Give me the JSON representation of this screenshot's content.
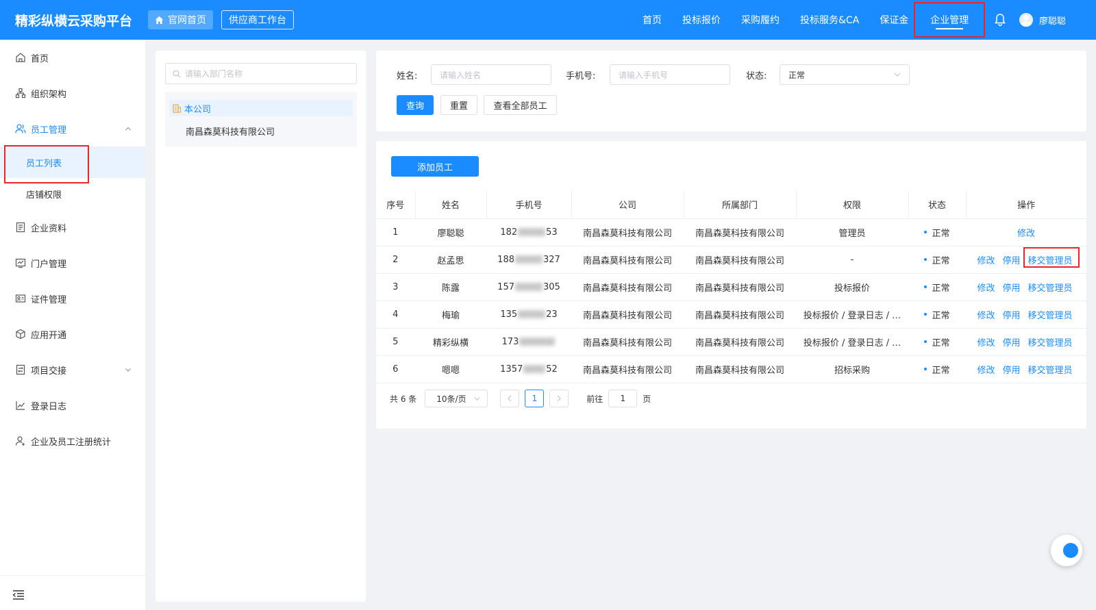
{
  "header": {
    "brand": "精彩纵横云采购平台",
    "home_btn": "官网首页",
    "workbench_btn": "供应商工作台",
    "nav": [
      "首页",
      "投标报价",
      "采购履约",
      "投标服务&CA",
      "保证金"
    ],
    "nav_active": "企业管理",
    "username": "廖聪聪"
  },
  "sidebar": {
    "items": [
      {
        "label": "首页",
        "icon": "home-icon"
      },
      {
        "label": "组织架构",
        "icon": "org-chart-icon"
      }
    ],
    "employee": {
      "label": "员工管理",
      "icon": "users-icon",
      "sub": [
        "员工列表",
        "店铺权限"
      ]
    },
    "items_after": [
      {
        "label": "企业资料",
        "icon": "document-icon"
      },
      {
        "label": "门户管理",
        "icon": "monitor-icon"
      },
      {
        "label": "证件管理",
        "icon": "id-card-icon"
      },
      {
        "label": "应用开通",
        "icon": "cube-icon"
      },
      {
        "label": "项目交接",
        "icon": "transfer-icon"
      },
      {
        "label": "登录日志",
        "icon": "chart-icon"
      },
      {
        "label": "企业及员工注册统计",
        "icon": "user-icon"
      }
    ]
  },
  "dept": {
    "search_placeholder": "请输入部门名称",
    "root": "本公司",
    "child": "南昌森莫科技有限公司"
  },
  "filters": {
    "name_label": "姓名:",
    "name_placeholder": "请输入姓名",
    "phone_label": "手机号:",
    "phone_placeholder": "请输入手机号",
    "status_label": "状态:",
    "status_value": "正常",
    "query_btn": "查询",
    "reset_btn": "重置",
    "view_all_btn": "查看全部员工"
  },
  "table": {
    "add_btn": "添加员工",
    "headers": [
      "序号",
      "姓名",
      "手机号",
      "公司",
      "所属部门",
      "权限",
      "状态",
      "操作"
    ],
    "rows": [
      {
        "no": "1",
        "name": "廖聪聪",
        "phone_a": "182",
        "phone_b": "53",
        "company": "南昌森莫科技有限公司",
        "dept": "南昌森莫科技有限公司",
        "perm": "管理员",
        "status": "正常"
      },
      {
        "no": "2",
        "name": "赵孟思",
        "phone_a": "188",
        "phone_b": "327",
        "company": "南昌森莫科技有限公司",
        "dept": "南昌森莫科技有限公司",
        "perm": "-",
        "status": "正常"
      },
      {
        "no": "3",
        "name": "陈露",
        "phone_a": "157",
        "phone_b": "305",
        "company": "南昌森莫科技有限公司",
        "dept": "南昌森莫科技有限公司",
        "perm": "投标报价",
        "status": "正常"
      },
      {
        "no": "4",
        "name": "梅瑜",
        "phone_a": "135",
        "phone_b": "23",
        "company": "南昌森莫科技有限公司",
        "dept": "南昌森莫科技有限公司",
        "perm": "投标报价 / 登录日志 / …",
        "status": "正常"
      },
      {
        "no": "5",
        "name": "精彩纵横",
        "phone_a": "173",
        "phone_b": "",
        "company": "南昌森莫科技有限公司",
        "dept": "南昌森莫科技有限公司",
        "perm": "投标报价 / 登录日志 / …",
        "status": "正常"
      },
      {
        "no": "6",
        "name": "嗯嗯",
        "phone_a": "1357",
        "phone_b": "52",
        "company": "南昌森莫科技有限公司",
        "dept": "南昌森莫科技有限公司",
        "perm": "招标采购",
        "status": "正常"
      }
    ],
    "op_edit": "修改",
    "op_disable": "停用",
    "op_transfer": "移交管理员"
  },
  "pager": {
    "total": "共 6 条",
    "page_size": "10条/页",
    "current": "1",
    "goto_label": "前往",
    "goto_value": "1",
    "page_unit": "页"
  },
  "colors": {
    "primary": "#1a8cff",
    "highlight": "#e8242c"
  }
}
